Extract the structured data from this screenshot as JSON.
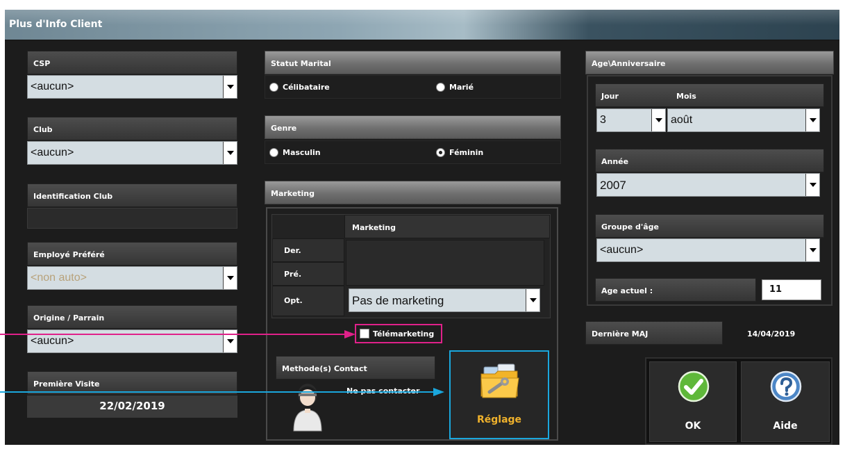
{
  "window": {
    "title": "Plus d'Info Client"
  },
  "left": {
    "csp": {
      "label": "CSP",
      "value": "<aucun>"
    },
    "club": {
      "label": "Club",
      "value": "<aucun>"
    },
    "identification_club": {
      "label": "Identification Club",
      "value": ""
    },
    "employe_prefere": {
      "label": "Employé Préféré",
      "value": "<non auto>"
    },
    "origine_parrain": {
      "label": "Origine / Parrain",
      "value": "<aucun>"
    },
    "premiere_visite": {
      "label": "Première Visite",
      "value": "22/02/2019"
    }
  },
  "middle": {
    "statut_marital": {
      "label": "Statut Marital",
      "options": [
        {
          "label": "Célibataire",
          "checked": false
        },
        {
          "label": "Marié",
          "checked": false
        }
      ]
    },
    "genre": {
      "label": "Genre",
      "options": [
        {
          "label": "Masculin",
          "checked": false
        },
        {
          "label": "Féminin",
          "checked": true
        }
      ]
    },
    "marketing": {
      "label": "Marketing",
      "table_header": "Marketing",
      "rows": [
        "Der.",
        "Pré.",
        "Opt."
      ],
      "opt_value": "Pas de marketing",
      "telemarketing": {
        "label": "Télémarketing",
        "checked": false
      },
      "methode_contact": {
        "label": "Methode(s) Contact",
        "value": "Ne pas contacter"
      },
      "reglage_button": "Réglage"
    }
  },
  "right": {
    "age_anniversaire": {
      "label": "Age\\Anniversaire",
      "jour_label": "Jour",
      "mois_label": "Mois",
      "jour_value": "3",
      "mois_value": "août",
      "annee_label": "Année",
      "annee_value": "2007",
      "groupe_label": "Groupe d'âge",
      "groupe_value": "<aucun>",
      "age_actuel_label": "Age actuel :",
      "age_actuel_value": "11"
    },
    "derniere_maj": {
      "label": "Dernière MAJ",
      "value": "14/04/2019"
    },
    "ok_button": "OK",
    "aide_button": "Aide"
  },
  "colors": {
    "magenta_highlight": "#e0218a",
    "cyan_highlight": "#1aa7dd",
    "combo_bg": "#d4dde2",
    "window_bg": "#1c1c1c"
  },
  "icons": [
    "checkmark-icon",
    "help-icon",
    "tools-folder-icon",
    "person-avatar-icon"
  ]
}
